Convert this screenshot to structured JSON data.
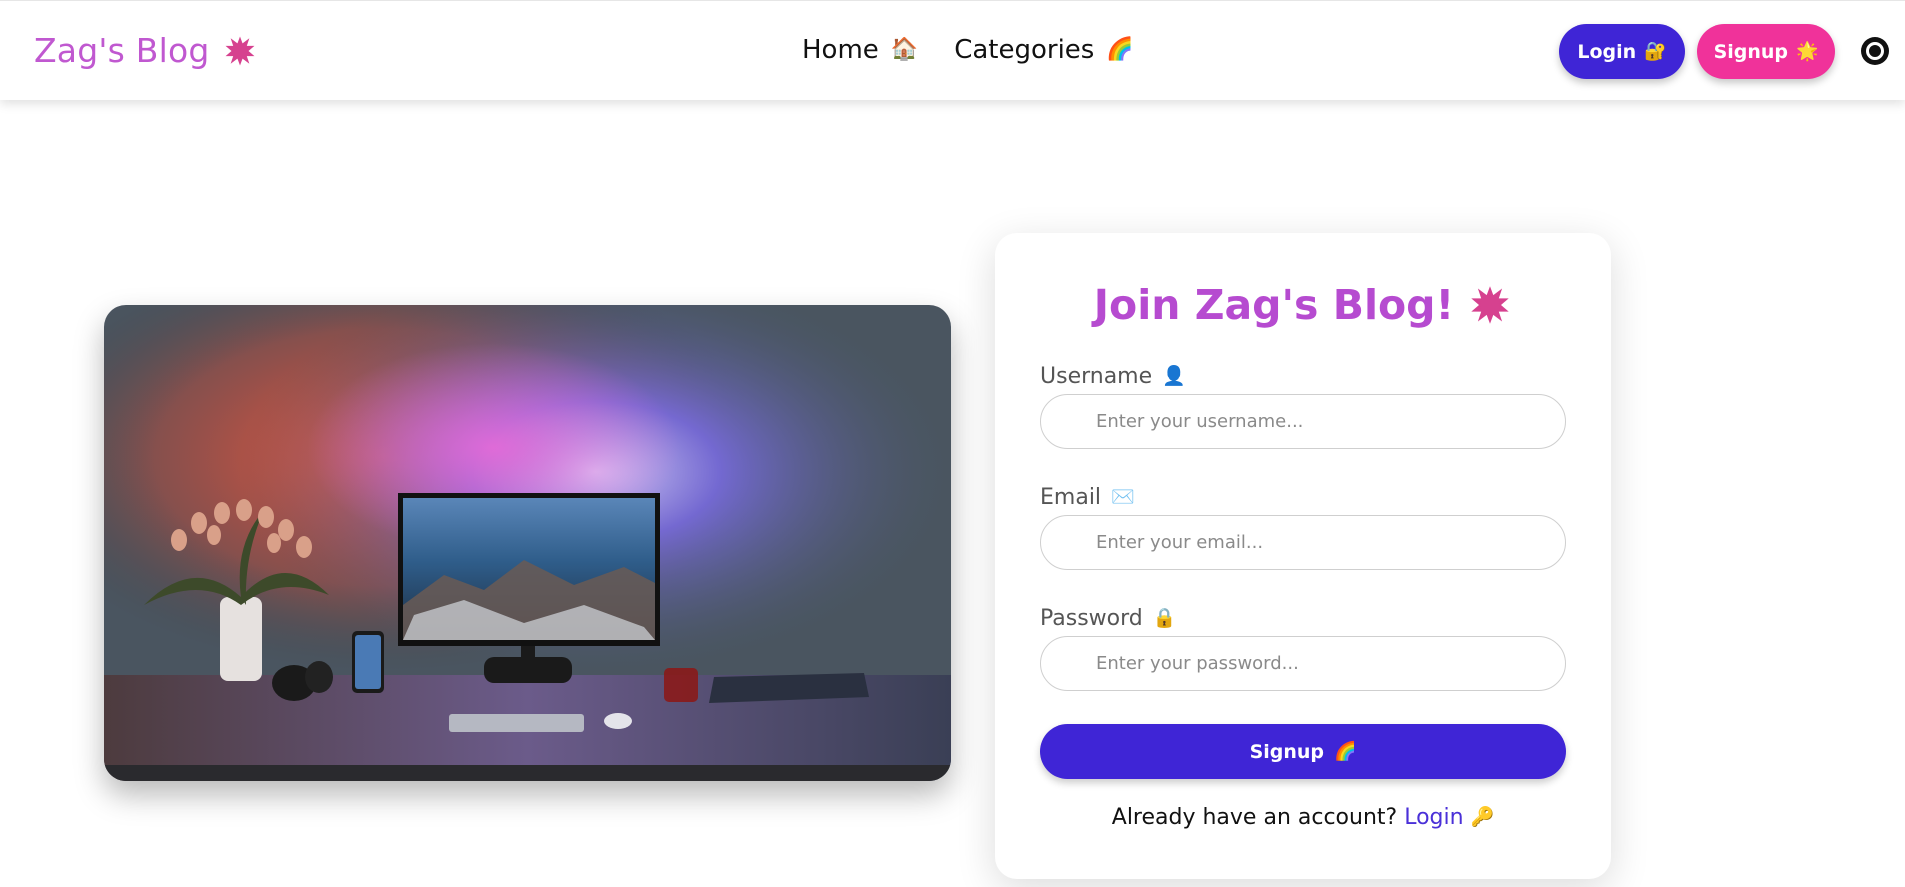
{
  "navbar": {
    "brand": "Zag's Blog",
    "brand_icon": "splat-icon",
    "links": [
      {
        "label": "Home",
        "icon": "house-icon",
        "emoji": "🏠"
      },
      {
        "label": "Categories",
        "icon": "rainbow-icon",
        "emoji": "🌈"
      }
    ],
    "login_label": "Login",
    "login_emoji": "🔐",
    "signup_label": "Signup",
    "signup_emoji": "🌟",
    "theme_toggle_icon": "circle-toggle-icon"
  },
  "colors": {
    "brand": "#c058d0",
    "primary": "#3f25d6",
    "accent_pink": "#f0329a"
  },
  "signup_form": {
    "title": "Join Zag's Blog!",
    "title_icon": "splat-icon",
    "username": {
      "label": "Username",
      "emoji": "👤",
      "placeholder": "Enter your username...",
      "value": ""
    },
    "email": {
      "label": "Email",
      "emoji": "✉️",
      "placeholder": "Enter your email...",
      "value": ""
    },
    "password": {
      "label": "Password",
      "emoji": "🔒",
      "placeholder": "Enter your password...",
      "value": ""
    },
    "submit_label": "Signup",
    "submit_emoji": "🌈",
    "already_text": "Already have an account?",
    "login_link": "Login",
    "login_link_emoji": "🔑"
  },
  "hero": {
    "image_subject": "desk-setup-photo"
  }
}
